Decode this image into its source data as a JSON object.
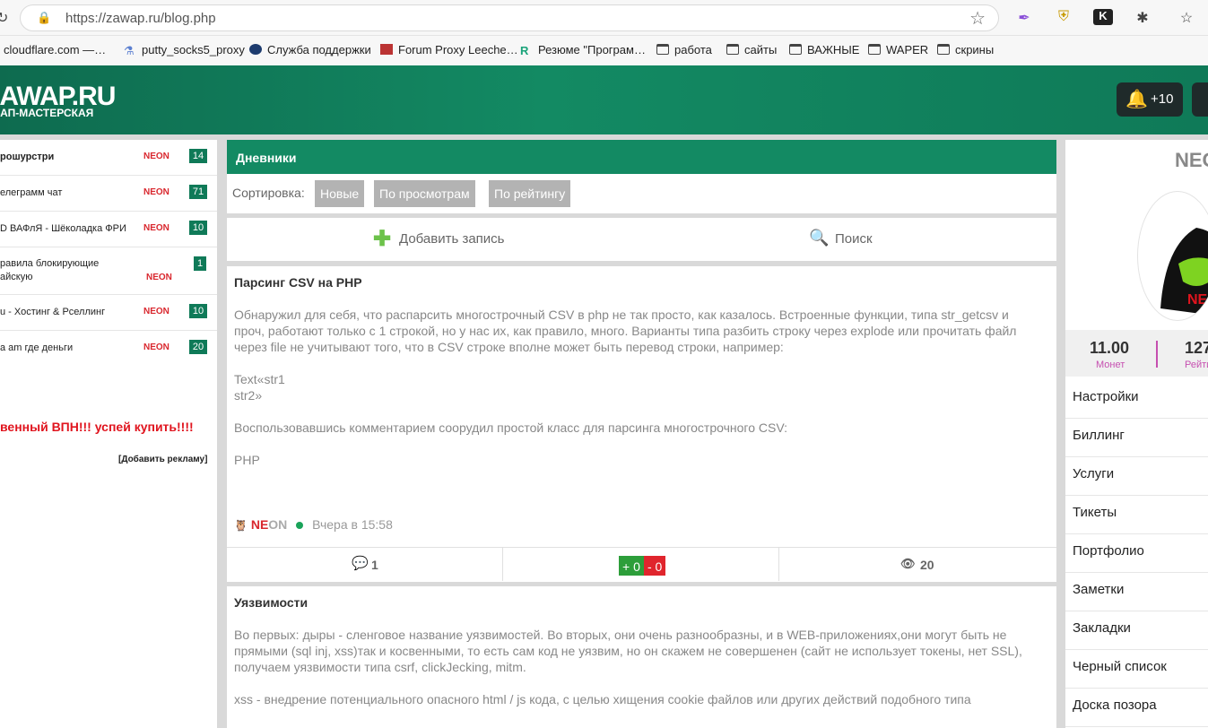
{
  "browser": {
    "url": "https://zawap.ru/blog.php",
    "bookmarks": [
      "cloudflare.com —…",
      "putty_socks5_proxy",
      "Служба поддержки",
      "Forum Proxy Leeche…",
      "Резюме \"Програм…",
      "работа",
      "сайты",
      "ВАЖНЫЕ",
      "WAPER",
      "скрины"
    ]
  },
  "header": {
    "logo": "ZAWAP.RU",
    "logo_sub": "ВАП-МАСТЕРСКАЯ",
    "notif_count": "+10"
  },
  "left": {
    "rows": [
      {
        "title": "рошурстри",
        "author": "NEON",
        "count": "14"
      },
      {
        "title": "елеграмм чат",
        "author": "NEON",
        "count": "71"
      },
      {
        "title": "D ВАФлЯ - Шёколадка ФРИ",
        "author": "NEON",
        "count": "10"
      },
      {
        "title": "равила блокирующие",
        "title2": "айскую",
        "author": "NEON",
        "count": "1"
      },
      {
        "title": "u - Хостинг & Рселлинг",
        "author": "NEON",
        "count": "10"
      },
      {
        "title": "а am где деньги",
        "author": "NEON",
        "count": "20"
      }
    ],
    "promo": "венный ВПН!!! успей купить!!!!",
    "add_ad": "[Добавить рекламу]"
  },
  "main": {
    "title": "Дневники",
    "sort_label": "Сортировка:",
    "sort": [
      "Новые",
      "По просмотрам",
      "По рейтингу"
    ],
    "add_label": "Добавить запись",
    "search_label": "Поиск",
    "post1": {
      "title": "Парсинг CSV на PHP",
      "p1": "Обнаружил для себя, что распарсить многострочный CSV в php не так просто, как казалось. Встроенные функции, типа str_getcsv и проч, работают только с 1 строкой, но у нас их, как правило, много. Варианты типа разбить строку через explode или прочитать файл через file не учитывают того, что в CSV строке вполне может быть перевод строки, например:",
      "p2": "Text«str1",
      "p3": "str2»",
      "p4": "Воспользовавшись комментарием соорудил простой класс для парсинга многострочного CSV:",
      "p5": "PHP",
      "author_ne": "NE",
      "author_on": "ON",
      "time": "Вчера в 15:58",
      "comments": "1",
      "plus": "+ 0",
      "minus": "- 0",
      "views": "20"
    },
    "post2": {
      "title": "Уязвимости",
      "p1": "Во первых: дыры - сленговое название уязвимостей. Во вторых, они очень разнообразны, и в WEB-приложениях,они могут быть не прямыми (sql inj, xss)так и косвенными, то есть сам код не уязвим, но он скажем не совершенен (сайт не использует токены, нет SSL), получаем уязвимости типа csrf, clickJecking, mitm.",
      "p2": "xss - внедрение потенциального опасного html / js кода, с целью хищения cookie файлов или других действий подобного типа"
    }
  },
  "right": {
    "name": "NEON",
    "coins": "11.00",
    "coins_label": "Монет",
    "rating": "127",
    "rating_label": "Рейтинг",
    "menu": [
      "Настройки",
      "Биллинг",
      "Услуги",
      "Тикеты",
      "Портфолио",
      "Заметки",
      "Закладки",
      "Черный список",
      "Доска позора"
    ]
  }
}
